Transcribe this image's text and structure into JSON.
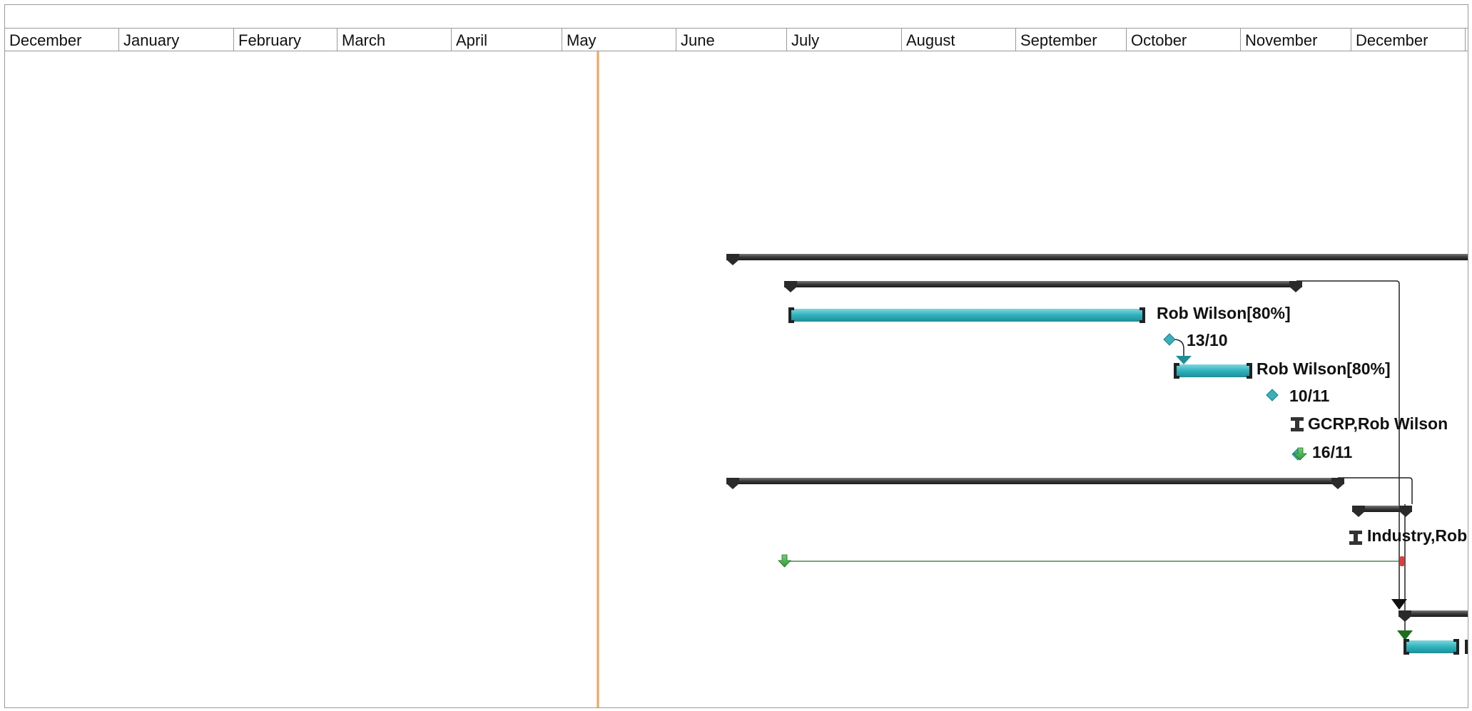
{
  "timescale": {
    "months": [
      "December",
      "January",
      "February",
      "March",
      "April",
      "May",
      "June",
      "July",
      "August",
      "September",
      "October",
      "November",
      "December"
    ]
  },
  "colors": {
    "summary_bar": "#3a3a3a",
    "task_bar": "#2fb2bd",
    "milestone": "#3ab0bb",
    "today_line": "#f2a25c",
    "deadline_arrow": "#2e9b3a",
    "link_line": "#222222",
    "gridline": "#9a9a9a"
  },
  "labels": {
    "task_1_resource": "Rob Wilson[80%]",
    "milestone_1_date": "13/10",
    "task_2_resource": "Rob Wilson[80%]",
    "milestone_2_date": "10/11",
    "resource_3": "GCRP,Rob Wilson",
    "milestone_3_date": "16/11",
    "resource_4": "Industry,Rob"
  }
}
